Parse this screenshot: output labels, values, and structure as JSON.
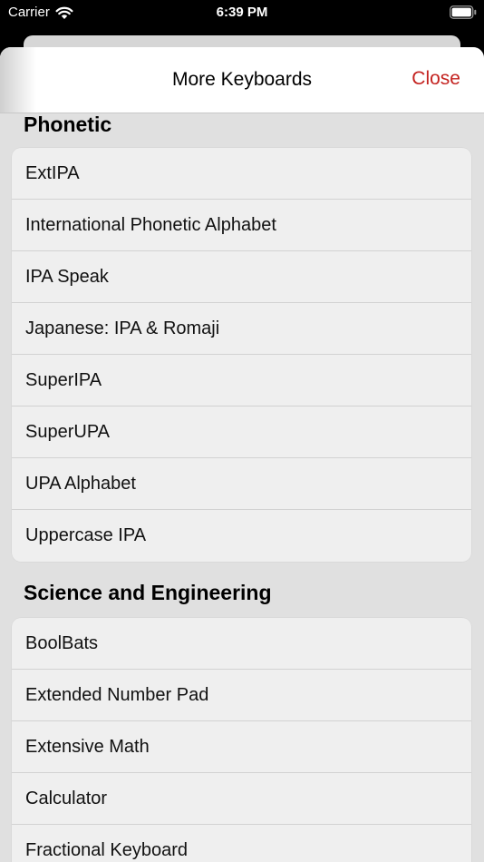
{
  "status_bar": {
    "carrier": "Carrier",
    "time": "6:39 PM"
  },
  "nav": {
    "title": "More Keyboards",
    "close_label": "Close",
    "accent_color": "#c42320"
  },
  "sections": [
    {
      "title": "Phonetic",
      "items": [
        "ExtIPA",
        "International Phonetic Alphabet",
        "IPA Speak",
        "Japanese: IPA & Romaji",
        "SuperIPA",
        "SuperUPA",
        "UPA Alphabet",
        "Uppercase IPA"
      ]
    },
    {
      "title": "Science and Engineering",
      "items": [
        "BoolBats",
        "Extended Number Pad",
        "Extensive Math",
        "Calculator",
        "Fractional Keyboard"
      ]
    }
  ]
}
